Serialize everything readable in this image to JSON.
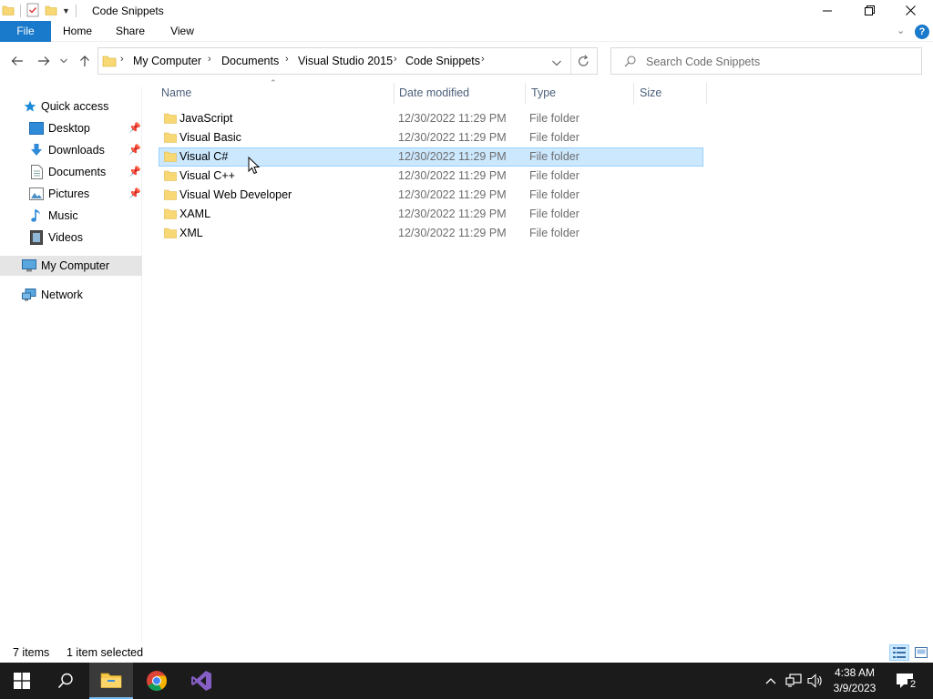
{
  "window": {
    "title": "Code Snippets"
  },
  "ribbon": {
    "tabs": [
      "File",
      "Home",
      "Share",
      "View"
    ]
  },
  "address": {
    "crumbs": [
      "My Computer",
      "Documents",
      "Visual Studio 2015",
      "Code Snippets"
    ]
  },
  "search": {
    "placeholder": "Search Code Snippets"
  },
  "nav": {
    "quick_access": "Quick access",
    "items": [
      "Desktop",
      "Downloads",
      "Documents",
      "Pictures",
      "Music",
      "Videos"
    ],
    "my_computer": "My Computer",
    "network": "Network"
  },
  "columns": {
    "name": "Name",
    "date": "Date modified",
    "type": "Type",
    "size": "Size"
  },
  "files": [
    {
      "name": "JavaScript",
      "date": "12/30/2022 11:29 PM",
      "type": "File folder"
    },
    {
      "name": "Visual Basic",
      "date": "12/30/2022 11:29 PM",
      "type": "File folder"
    },
    {
      "name": "Visual C#",
      "date": "12/30/2022 11:29 PM",
      "type": "File folder",
      "selected": true
    },
    {
      "name": "Visual C++",
      "date": "12/30/2022 11:29 PM",
      "type": "File folder"
    },
    {
      "name": "Visual Web Developer",
      "date": "12/30/2022 11:29 PM",
      "type": "File folder"
    },
    {
      "name": "XAML",
      "date": "12/30/2022 11:29 PM",
      "type": "File folder"
    },
    {
      "name": "XML",
      "date": "12/30/2022 11:29 PM",
      "type": "File folder"
    }
  ],
  "status": {
    "count": "7 items",
    "selection": "1 item selected"
  },
  "taskbar": {
    "time": "4:38 AM",
    "date": "3/9/2023",
    "notifications": "2"
  },
  "colors": {
    "accent": "#1979ca",
    "selection_bg": "#cce8ff",
    "selection_border": "#99d1ff",
    "taskbar_bg": "#1b1b1b"
  }
}
